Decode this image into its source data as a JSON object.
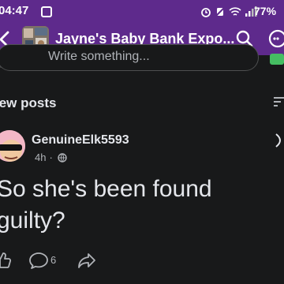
{
  "status_bar": {
    "time": "04:47",
    "battery": "77%"
  },
  "header": {
    "group_title": "Jayne's Baby Bank Expo...",
    "back_icon": "back-arrow-icon",
    "search_icon": "search-icon",
    "more_icon": "more-icon"
  },
  "composer": {
    "placeholder": "Write something..."
  },
  "feed": {
    "section_title": "New posts",
    "section_title_visible": "lew posts"
  },
  "post": {
    "author": "GenuineElk5593",
    "time": "4h",
    "audience_icon": "globe-icon",
    "text": "So she's been found guilty?",
    "line1": "So she's been found",
    "line2": "guilty?",
    "comment_count": "6"
  }
}
